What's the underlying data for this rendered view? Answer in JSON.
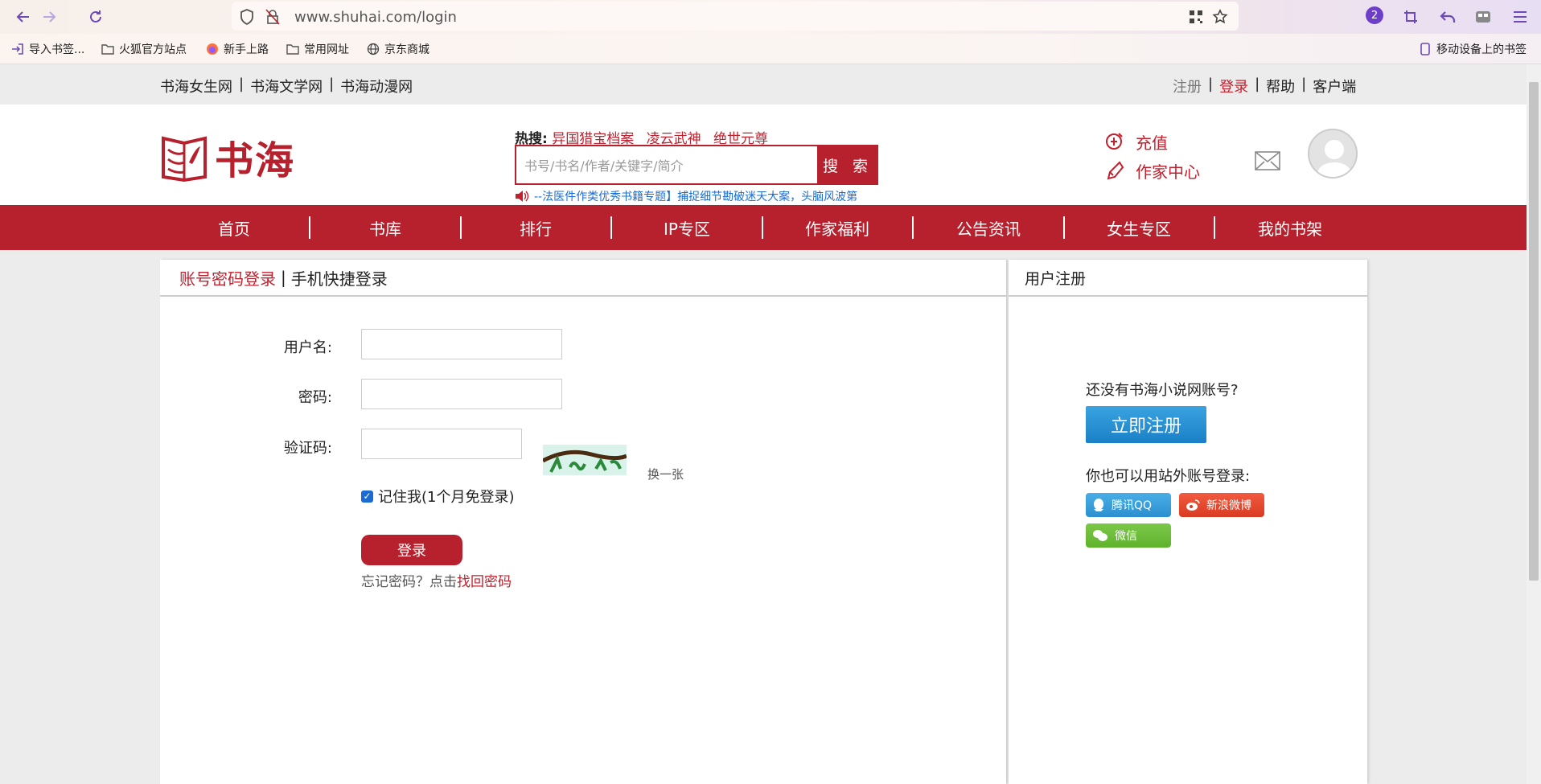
{
  "browser": {
    "url": "www.shuhai.com/login",
    "badge_count": "2",
    "bookmarks": [
      "导入书签...",
      "火狐官方站点",
      "新手上路",
      "常用网址",
      "京东商城"
    ],
    "mobile_bookmarks": "移动设备上的书签"
  },
  "topbar": {
    "left_links": [
      "书海女生网",
      "书海文学网",
      "书海动漫网"
    ],
    "separator": "|",
    "right_links": [
      "注册",
      "登录",
      "帮助",
      "客户端"
    ]
  },
  "header": {
    "logo_text": "书海",
    "hot_label": "热搜:",
    "hot_items": [
      "异国猎宝档案",
      "凌云武神",
      "绝世元尊"
    ],
    "search_placeholder": "书号/书名/作者/关键字/简介",
    "search_button": "搜 索",
    "notice": "--法医件作类优秀书籍专题】捕捉细节勘破迷天大案，头脑风波第",
    "recharge": "充值",
    "author_center": "作家中心"
  },
  "nav": {
    "items": [
      "首页",
      "书库",
      "排行",
      "IP专区",
      "作家福利",
      "公告资讯",
      "女生专区",
      "我的书架"
    ]
  },
  "login": {
    "tab_active": "账号密码登录",
    "tab_sep": "|",
    "tab_other": "手机快捷登录",
    "username_label": "用户名:",
    "password_label": "密码:",
    "captcha_label": "验证码:",
    "swap_captcha": "换一张",
    "remember_me": "记住我(1个月免登录)",
    "login_button": "登录",
    "forgot_prefix": "忘记密码？点击",
    "forgot_link": "找回密码"
  },
  "register": {
    "title": "用户注册",
    "question": "还没有书海小说网账号?",
    "register_button": "立即注册",
    "other_login": "你也可以用站外账号登录:",
    "qq_label": "腾讯QQ",
    "weibo_label": "新浪微博",
    "wechat_label": "微信"
  },
  "colors": {
    "brand_red": "#b7212d",
    "link_blue": "#1a6bd2"
  }
}
